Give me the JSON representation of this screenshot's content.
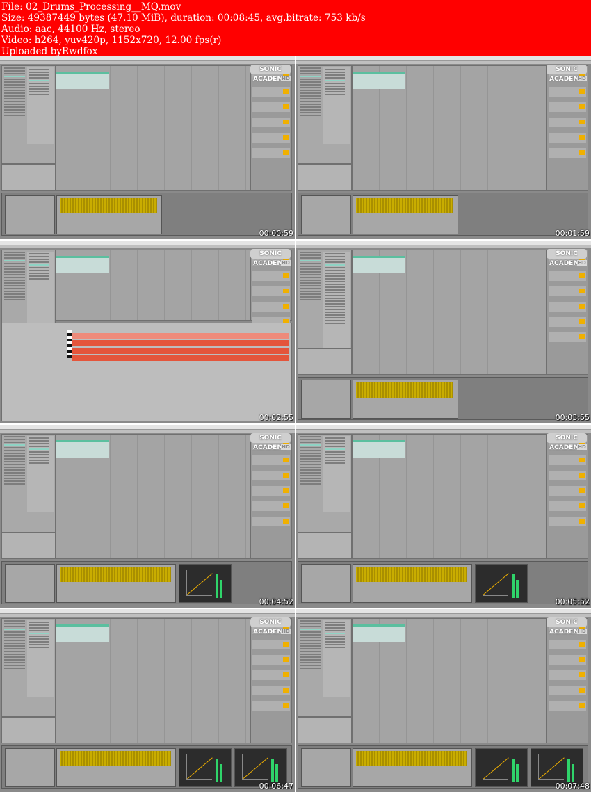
{
  "header": {
    "lines": [
      "File: 02_Drums_Processing__MQ.mov",
      "Size: 49387449 bytes (47.10 MiB), duration: 00:08:45, avg.bitrate: 753 kb/s",
      "Audio: aac, 44100 Hz, stereo",
      "Video: h264, yuv420p, 1152x720, 12.00 fps(r)",
      "Uploaded byRwdfox"
    ],
    "background_color": "#ff0000",
    "text_color": "#ffffff"
  },
  "overlay": {
    "logo_text": "SONIC ACADEMY",
    "hd_text": "HD"
  },
  "thumbnails": [
    {
      "timestamp": "00:00:59",
      "view": "arrange",
      "devices": "sample"
    },
    {
      "timestamp": "00:01:59",
      "view": "arrange",
      "devices": "sample"
    },
    {
      "timestamp": "00:02:55",
      "view": "midi-editor",
      "devices": "none"
    },
    {
      "timestamp": "00:03:55",
      "view": "arrange-browser",
      "devices": "sample"
    },
    {
      "timestamp": "00:04:52",
      "view": "arrange",
      "devices": "sample-comp"
    },
    {
      "timestamp": "00:05:52",
      "view": "arrange",
      "devices": "sample-comp"
    },
    {
      "timestamp": "00:06:47",
      "view": "arrange",
      "devices": "sample-comp-comp"
    },
    {
      "timestamp": "00:07:48",
      "view": "arrange",
      "devices": "sample-comp-comp"
    }
  ]
}
